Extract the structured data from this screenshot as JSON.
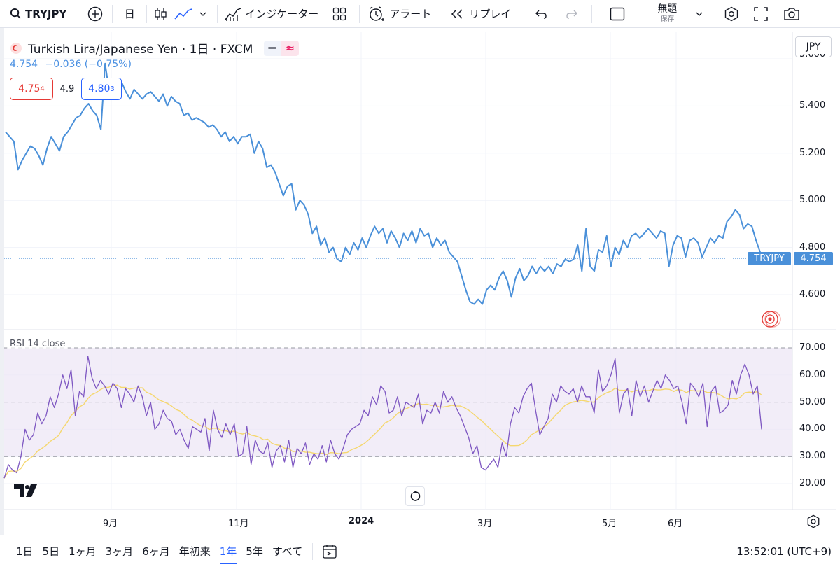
{
  "toolbar": {
    "symbol": "TRYJPY",
    "interval": "日",
    "indicators_label": "インジケーター",
    "alert_label": "アラート",
    "replay_label": "リプレイ",
    "layout_name": "無題",
    "save_label": "保存"
  },
  "legend": {
    "title": "Turkish Lira/Japanese Yen · 1日 · FXCM",
    "last": "4.754",
    "change": "−0.036 (−0.75%)",
    "sell_price": "4.75",
    "sell_superscript": "4",
    "spread": "4.9",
    "buy_price": "4.80",
    "buy_superscript": "3"
  },
  "price_axis": {
    "currency": "JPY",
    "labels": [
      "5.600",
      "5.400",
      "5.200",
      "5.000",
      "4.800",
      "4.600"
    ],
    "last_price_tag": "4.754",
    "symbol_tag": "TRYJPY"
  },
  "rsi": {
    "label": "RSI 14 close",
    "axis_labels": [
      "70.00",
      "60.00",
      "50.00",
      "40.00",
      "30.00",
      "20.00"
    ]
  },
  "time_axis": {
    "labels": [
      "9月",
      "11月",
      "2024",
      "3月",
      "5月",
      "6月"
    ]
  },
  "timeframes": [
    "1日",
    "5日",
    "1ヶ月",
    "3ヶ月",
    "6ヶ月",
    "年初来",
    "1年",
    "5年",
    "すべて"
  ],
  "active_timeframe": "1年",
  "clock": "13:52:01 (UTC+9)",
  "colors": {
    "price_line": "#4a90d9",
    "rsi_line": "#7e57c2",
    "rsi_ma": "#f5d76e",
    "sell_box": "#e53935",
    "buy_box": "#2962ff",
    "accent": "#2962ff"
  },
  "chart_data": {
    "type": "line",
    "price_series": [
      5.29,
      5.27,
      5.25,
      5.13,
      5.17,
      5.2,
      5.23,
      5.22,
      5.19,
      5.15,
      5.22,
      5.27,
      5.24,
      5.21,
      5.27,
      5.29,
      5.32,
      5.35,
      5.36,
      5.39,
      5.41,
      5.38,
      5.36,
      5.3,
      5.58,
      5.46,
      5.44,
      5.48,
      5.5,
      5.46,
      5.43,
      5.47,
      5.45,
      5.43,
      5.45,
      5.46,
      5.44,
      5.42,
      5.45,
      5.4,
      5.44,
      5.42,
      5.41,
      5.36,
      5.37,
      5.34,
      5.35,
      5.34,
      5.33,
      5.31,
      5.32,
      5.3,
      5.27,
      5.29,
      5.25,
      5.27,
      5.24,
      5.27,
      5.27,
      5.28,
      5.2,
      5.25,
      5.22,
      5.14,
      5.15,
      5.12,
      5.07,
      5.02,
      5.06,
      5.07,
      4.96,
      5.0,
      4.98,
      4.94,
      4.86,
      4.89,
      4.81,
      4.84,
      4.78,
      4.8,
      4.75,
      4.74,
      4.8,
      4.77,
      4.82,
      4.79,
      4.84,
      4.8,
      4.85,
      4.89,
      4.86,
      4.88,
      4.82,
      4.87,
      4.84,
      4.8,
      4.86,
      4.83,
      4.87,
      4.82,
      4.88,
      4.85,
      4.86,
      4.8,
      4.84,
      4.81,
      4.83,
      4.78,
      4.76,
      4.74,
      4.68,
      4.62,
      4.57,
      4.56,
      4.58,
      4.56,
      4.62,
      4.64,
      4.62,
      4.67,
      4.7,
      4.66,
      4.59,
      4.67,
      4.71,
      4.66,
      4.68,
      4.72,
      4.69,
      4.72,
      4.7,
      4.72,
      4.69,
      4.73,
      4.72,
      4.75,
      4.74,
      4.75,
      4.81,
      4.7,
      4.88,
      4.72,
      4.7,
      4.79,
      4.78,
      4.85,
      4.72,
      4.8,
      4.77,
      4.83,
      4.8,
      4.85,
      4.86,
      4.84,
      4.86,
      4.88,
      4.86,
      4.84,
      4.87,
      4.86,
      4.72,
      4.81,
      4.85,
      4.84,
      4.76,
      4.83,
      4.84,
      4.82,
      4.76,
      4.8,
      4.84,
      4.82,
      4.85,
      4.84,
      4.91,
      4.93,
      4.96,
      4.94,
      4.88,
      4.9,
      4.89,
      4.83,
      4.78
    ],
    "price_range": [
      4.5,
      5.6
    ],
    "rsi_series": [
      22,
      27,
      25,
      24,
      30,
      40,
      36,
      38,
      46,
      42,
      45,
      52,
      48,
      53,
      60,
      55,
      62,
      45,
      54,
      52,
      67,
      59,
      55,
      58,
      56,
      53,
      57,
      55,
      48,
      55,
      53,
      50,
      56,
      52,
      45,
      50,
      40,
      42,
      47,
      44,
      43,
      38,
      40,
      36,
      33,
      41,
      40,
      39,
      44,
      32,
      47,
      40,
      37,
      42,
      38,
      42,
      30,
      31,
      41,
      27,
      36,
      32,
      31,
      35,
      26,
      32,
      34,
      28,
      36,
      26,
      33,
      31,
      35,
      27,
      31,
      29,
      34,
      28,
      36,
      31,
      29,
      33,
      38,
      40,
      41,
      42,
      47,
      45,
      52,
      49,
      56,
      54,
      46,
      47,
      52,
      45,
      50,
      49,
      48,
      53,
      42,
      47,
      46,
      50,
      46,
      54,
      50,
      52,
      48,
      45,
      41,
      37,
      31,
      34,
      26,
      25,
      27,
      29,
      26,
      35,
      30,
      42,
      48,
      46,
      52,
      55,
      57,
      47,
      38,
      41,
      44,
      53,
      50,
      56,
      54,
      53,
      55,
      50,
      56,
      52,
      52,
      46,
      62,
      54,
      56,
      60,
      66,
      46,
      53,
      55,
      45,
      58,
      52,
      56,
      50,
      54,
      58,
      55,
      60,
      58,
      55,
      56,
      50,
      42,
      57,
      55,
      52,
      57,
      41,
      54,
      56,
      46,
      47,
      49,
      58,
      53,
      60,
      64,
      60,
      53,
      56,
      40
    ]
  }
}
